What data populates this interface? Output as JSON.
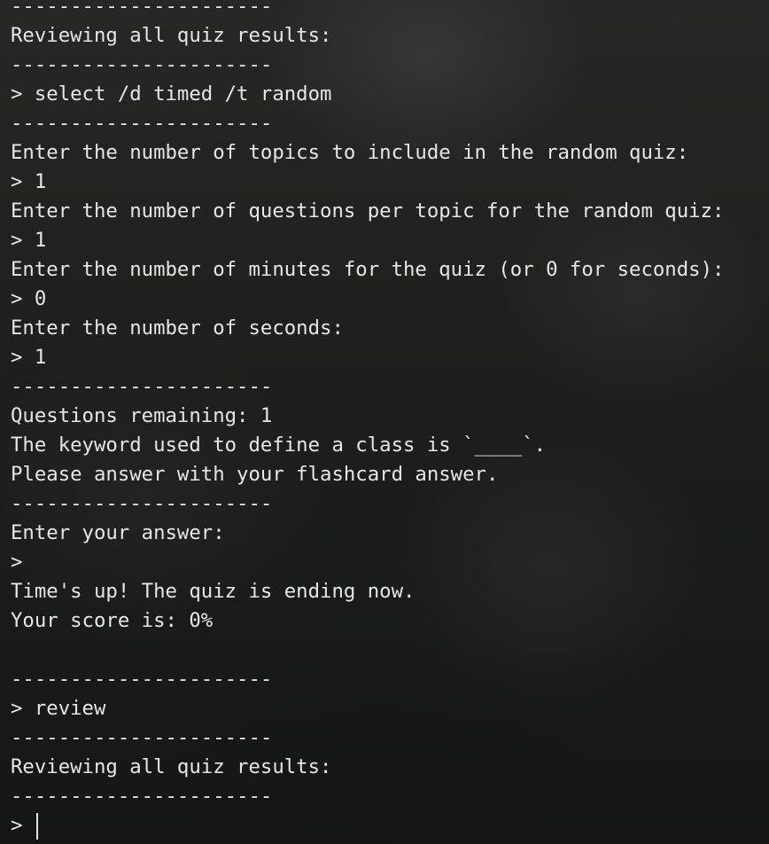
{
  "terminal": {
    "lines": [
      "----------------------",
      "Reviewing all quiz results:",
      "----------------------",
      "> select /d timed /t random",
      "----------------------",
      "Enter the number of topics to include in the random quiz:",
      "> 1",
      "Enter the number of questions per topic for the random quiz:",
      "> 1",
      "Enter the number of minutes for the quiz (or 0 for seconds):",
      "> 0",
      "Enter the number of seconds:",
      "> 1",
      "----------------------",
      "Questions remaining: 1",
      "The keyword used to define a class is `____`.",
      "Please answer with your flashcard answer.",
      "----------------------",
      "Enter your answer:",
      ">",
      "Time's up! The quiz is ending now.",
      "Your score is: 0%",
      "",
      "----------------------",
      "> review",
      "----------------------",
      "Reviewing all quiz results:",
      "----------------------"
    ],
    "prompt": "> "
  }
}
